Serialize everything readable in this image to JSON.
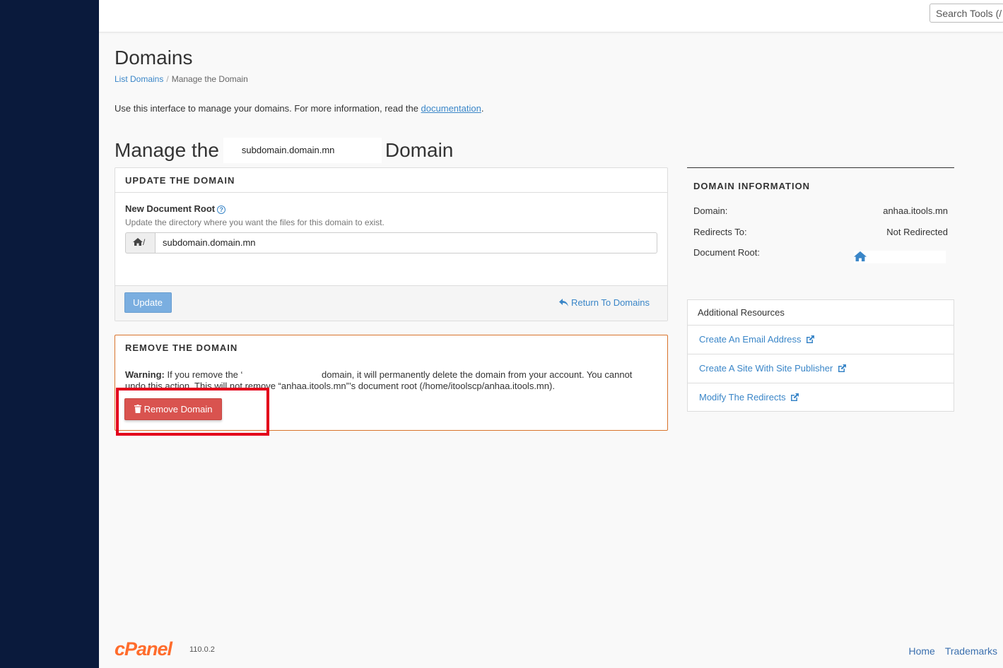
{
  "search": {
    "placeholder": "Search Tools (/"
  },
  "page": {
    "title": "Domains",
    "breadcrumb": {
      "link": "List Domains",
      "current": "Manage the Domain"
    },
    "intro_text": "Use this interface to manage your domains. For more information, read the ",
    "intro_link": "documentation",
    "intro_end": "."
  },
  "manage": {
    "prefix": "Manage the",
    "domain": "subdomain.domain.mn",
    "suffix": "Domain"
  },
  "update": {
    "heading": "UPDATE THE DOMAIN",
    "label": "New Document Root",
    "help": "Update the directory where you want the files for this domain to exist.",
    "addon": "/",
    "value": "subdomain.domain.mn",
    "button": "Update",
    "return_link": "Return To Domains"
  },
  "remove": {
    "heading": "REMOVE THE DOMAIN",
    "warning_label": "Warning:",
    "warning_pre": "If you remove the ‘",
    "warning_post": "domain, it will permanently delete the domain from your account. You cannot undo this action. This will not remove “anhaa.itools.mn”’s document root (/home/itoolscp/anhaa.itools.mn).",
    "button": "Remove Domain"
  },
  "info": {
    "heading": "DOMAIN INFORMATION",
    "domain_label": "Domain:",
    "domain_value": "anhaa.itools.mn",
    "redirects_label": "Redirects To:",
    "redirects_value": "Not Redirected",
    "docroot_label": "Document Root:"
  },
  "resources": {
    "heading": "Additional Resources",
    "items": [
      {
        "label": "Create An Email Address"
      },
      {
        "label": "Create A Site With Site Publisher"
      },
      {
        "label": "Modify The Redirects"
      }
    ]
  },
  "footer": {
    "logo": "cPanel",
    "version": "110.0.2",
    "home": "Home",
    "trademarks": "Trademarks"
  },
  "colors": {
    "sidebar": "#0a1a3c",
    "link": "#3a86c8",
    "danger": "#d9534f",
    "brand": "#ff6c2c"
  }
}
